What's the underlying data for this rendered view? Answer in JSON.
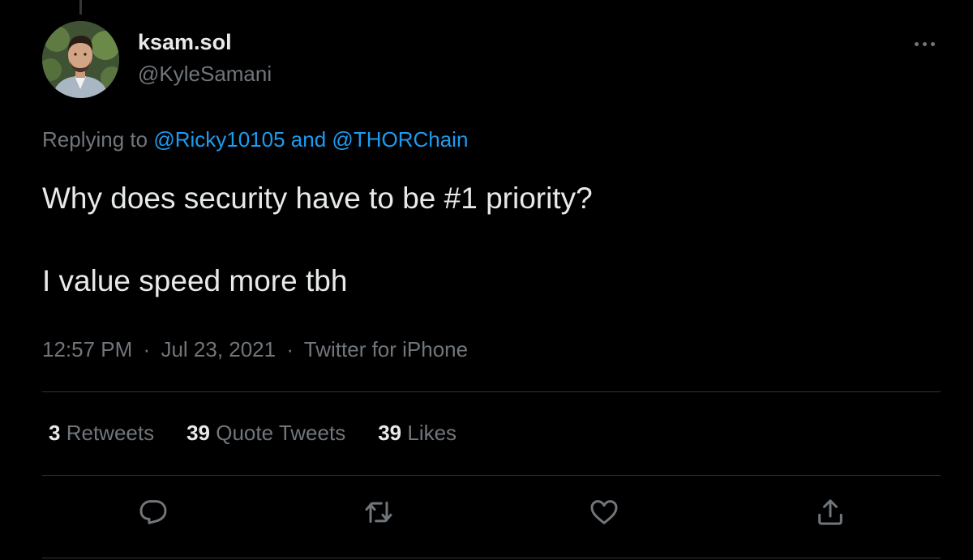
{
  "user": {
    "display_name": "ksam.sol",
    "handle": "@KyleSamani",
    "avatar_icon": "profile-photo"
  },
  "reply": {
    "prefix": "Replying to",
    "mention1": "@Ricky10105",
    "conjunction": "and",
    "mention2": "@THORChain"
  },
  "tweet": {
    "paragraphs": [
      "Why does security have to be #1 priority?",
      "I value speed more tbh"
    ]
  },
  "meta": {
    "time": "12:57 PM",
    "separator": "·",
    "date": "Jul 23, 2021",
    "source": "Twitter for iPhone"
  },
  "stats": {
    "retweets": {
      "count": "3",
      "label": "Retweets"
    },
    "quotes": {
      "count": "39",
      "label": "Quote Tweets"
    },
    "likes": {
      "count": "39",
      "label": "Likes"
    }
  },
  "actions": {
    "reply_icon": "reply-icon",
    "retweet_icon": "retweet-icon",
    "like_icon": "heart-icon",
    "share_icon": "share-icon"
  },
  "colors": {
    "background": "#000000",
    "text_primary": "#e7e9ea",
    "text_secondary": "#71767b",
    "link": "#1d9bf0",
    "divider": "#2f3336"
  }
}
